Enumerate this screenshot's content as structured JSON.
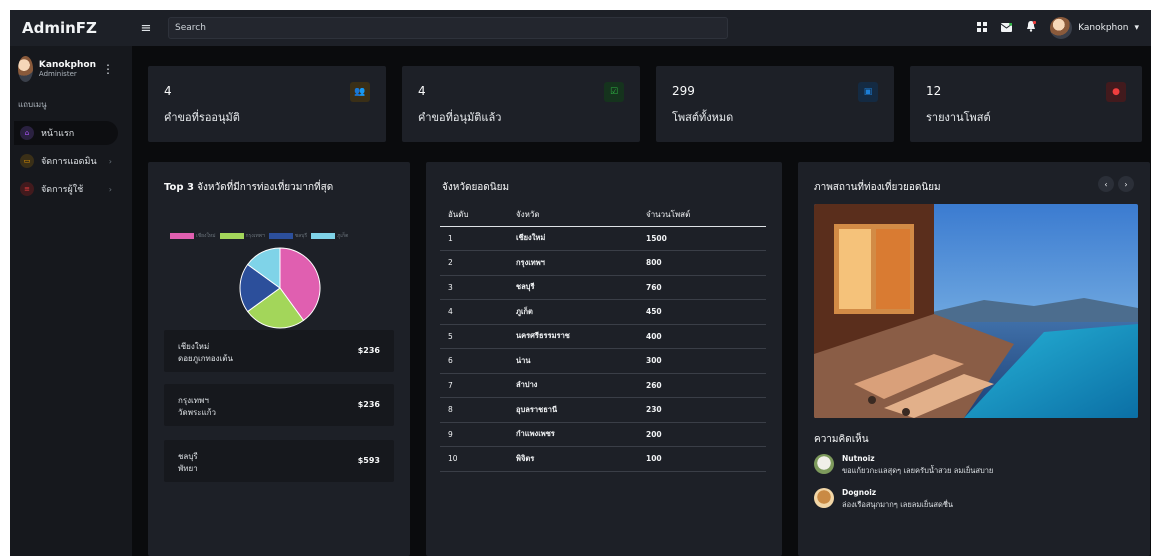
{
  "app": {
    "brand": "AdminFZ"
  },
  "topbar": {
    "search_placeholder": "Search",
    "user_name": "Kanokphon",
    "icons": [
      "grid-icon",
      "mail-icon",
      "bell-icon"
    ]
  },
  "sidebar": {
    "profile_name": "Kanokphon",
    "profile_role": "Administer",
    "menu_header": "แถบเมนู",
    "items": [
      {
        "label": "หน้าแรก",
        "icon": "home-icon",
        "color": "#a855f7"
      },
      {
        "label": "จัดการแอดมิน",
        "icon": "monitor-icon",
        "color": "#f59f00"
      },
      {
        "label": "จัดการผู้ใช้",
        "icon": "users-icon",
        "color": "#f03e3e"
      }
    ]
  },
  "stats": [
    {
      "value": "4",
      "label": "คำขอที่รออนุมัติ",
      "icon": "users-icon",
      "color": "#f59f00",
      "bg": "#3a2f17"
    },
    {
      "value": "4",
      "label": "คำขอที่อนุมัติแล้ว",
      "icon": "check-square-icon",
      "color": "#2fb344",
      "bg": "#15331d"
    },
    {
      "value": "299",
      "label": "โพสต์ทั้งหมด",
      "icon": "layers-icon",
      "color": "#1c7ed6",
      "bg": "#142a42"
    },
    {
      "value": "12",
      "label": "รายงานโพสต์",
      "icon": "alert-icon",
      "color": "#f03e3e",
      "bg": "#421a1d"
    }
  ],
  "top3": {
    "title_bold": "Top 3",
    "title_rest": " จังหวัดที่มีการท่องเที่ยวมากที่สุด",
    "legend": [
      {
        "name": "เชียงใหม่",
        "color": "#e05fb0"
      },
      {
        "name": "กรุงเทพฯ",
        "color": "#a3d65a"
      },
      {
        "name": "ชลบุรี",
        "color": "#2c4f9b"
      },
      {
        "name": "ภูเก็ต",
        "color": "#7fd3e8"
      }
    ],
    "pie": [
      {
        "value": 40,
        "color": "#e05fb0"
      },
      {
        "value": 25,
        "color": "#a3d65a"
      },
      {
        "value": 20,
        "color": "#2c4f9b"
      },
      {
        "value": 15,
        "color": "#7fd3e8"
      }
    ],
    "provinces": [
      {
        "province": "เชียงใหม่",
        "place": "ดอยภูเกทองเต้น",
        "amount": "$236"
      },
      {
        "province": "กรุงเทพฯ",
        "place": "วัดพระแก้ว",
        "amount": "$236"
      },
      {
        "province": "ชลบุรี",
        "place": "พัทยา",
        "amount": "$593"
      }
    ]
  },
  "popular": {
    "title": "จังหวัดยอดนิยม",
    "columns": [
      "อันดับ",
      "จังหวัด",
      "จำนวนโพสต์"
    ],
    "rows": [
      [
        "1",
        "เชียงใหม่",
        "1500"
      ],
      [
        "2",
        "กรุงเทพฯ",
        "800"
      ],
      [
        "3",
        "ชลบุรี",
        "760"
      ],
      [
        "4",
        "ภูเก็ต",
        "450"
      ],
      [
        "5",
        "นครศรีธรรมราช",
        "400"
      ],
      [
        "6",
        "น่าน",
        "300"
      ],
      [
        "7",
        "ลำปาง",
        "260"
      ],
      [
        "8",
        "อุบลราชธานี",
        "230"
      ],
      [
        "9",
        "กำแพงเพชร",
        "200"
      ],
      [
        "10",
        "พิจิตร",
        "100"
      ]
    ]
  },
  "gallery": {
    "title": "ภาพสถานที่ท่องเที่ยวยอดนิยม",
    "prev": "‹",
    "next": "›",
    "comments_title": "ความคิดเห็น",
    "comments": [
      {
        "name": "Nutnoiz",
        "text": "ขอแก้ยวกะแลสุดๆ เลยครับน้ำสวย ลมเย็นสบาย"
      },
      {
        "name": "Dognoiz",
        "text": "ล่องเรือสนุกมากๆ เลยลมเย็นสดชื่น"
      }
    ]
  }
}
